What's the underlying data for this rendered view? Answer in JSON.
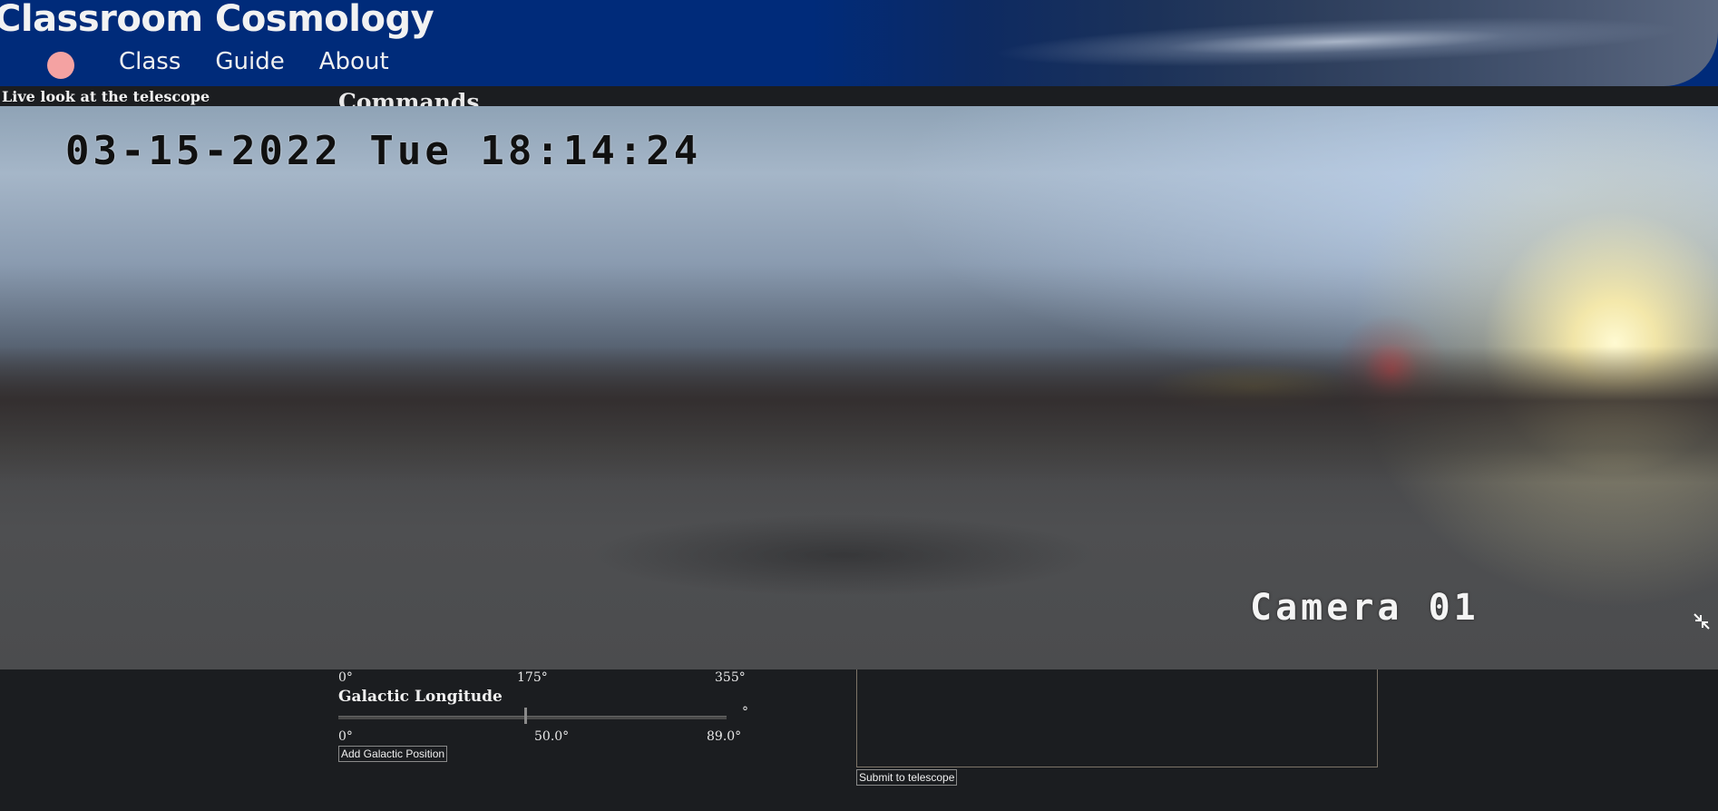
{
  "header": {
    "site_title": "Classroom Cosmology",
    "nav": [
      "Class",
      "Guide",
      "About"
    ],
    "logo_color": "#f4a2a2",
    "background_color": "#002b7a"
  },
  "live_section": {
    "title": "Live look at the telescope"
  },
  "commands_section": {
    "title": "Commands"
  },
  "camera_feed": {
    "timestamp": "03-15-2022 Tue 18:14:24",
    "camera_label": "Camera 01",
    "collapse_icon": "collapse-arrows-icon"
  },
  "first_slider": {
    "ticks": [
      "0°",
      "175°",
      "355°"
    ]
  },
  "galactic_longitude": {
    "label": "Galactic Longitude",
    "value": 50.0,
    "min": 0,
    "max": 89.0,
    "unit": "°",
    "ticks": [
      "0°",
      "50.0°",
      "89.0°"
    ],
    "add_button": "Add Galactic Position"
  },
  "command_box": {
    "submit_button": "Submit to telescope"
  },
  "colors": {
    "page_background": "#1b1d20",
    "text": "#e8e8e8"
  }
}
